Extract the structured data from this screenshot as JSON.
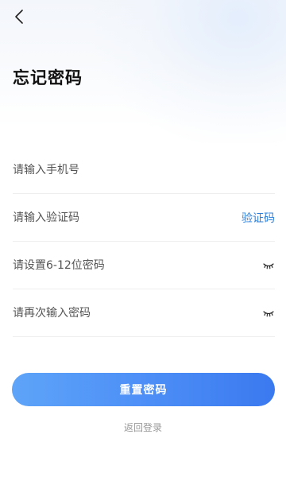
{
  "header": {
    "back_icon": "chevron-left-icon",
    "title": "忘记密码"
  },
  "form": {
    "phone_placeholder": "请输入手机号",
    "code_placeholder": "请输入验证码",
    "code_button_label": "验证码",
    "new_password_placeholder": "请设置6-12位密码",
    "confirm_password_placeholder": "请再次输入密码",
    "eye_icon": "eye-closed-icon"
  },
  "actions": {
    "reset_button_label": "重置密码",
    "back_to_login_label": "返回登录"
  },
  "colors": {
    "accent": "#2f7fd8",
    "button_gradient_start": "#5ea4f8",
    "button_gradient_end": "#3a79ef"
  }
}
